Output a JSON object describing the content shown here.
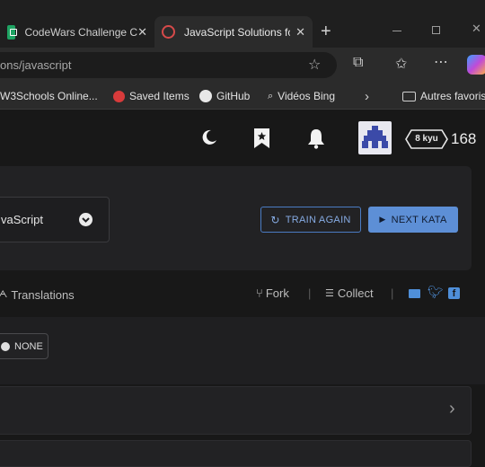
{
  "browser": {
    "tabs": [
      {
        "label": "CodeWars Challenge C"
      },
      {
        "label": "JavaScript Solutions fo"
      }
    ],
    "url": "ons/javascript",
    "bookmarks": [
      "W3Schools Online...",
      "Saved Items",
      "GitHub",
      "Vidéos Bing",
      "Autres favoris"
    ]
  },
  "nav": {
    "rank_badge": "8 kyu",
    "honor": "168"
  },
  "kata": {
    "language": "vaScript",
    "train_again": "TRAIN AGAIN",
    "next_kata": "NEXT KATA"
  },
  "actions": {
    "translations": "Translations",
    "fork": "Fork",
    "collect": "Collect"
  },
  "filter": {
    "none_label": "NONE"
  },
  "colors": {
    "accent": "#5d8fd6",
    "social": "#4f8fd9"
  }
}
